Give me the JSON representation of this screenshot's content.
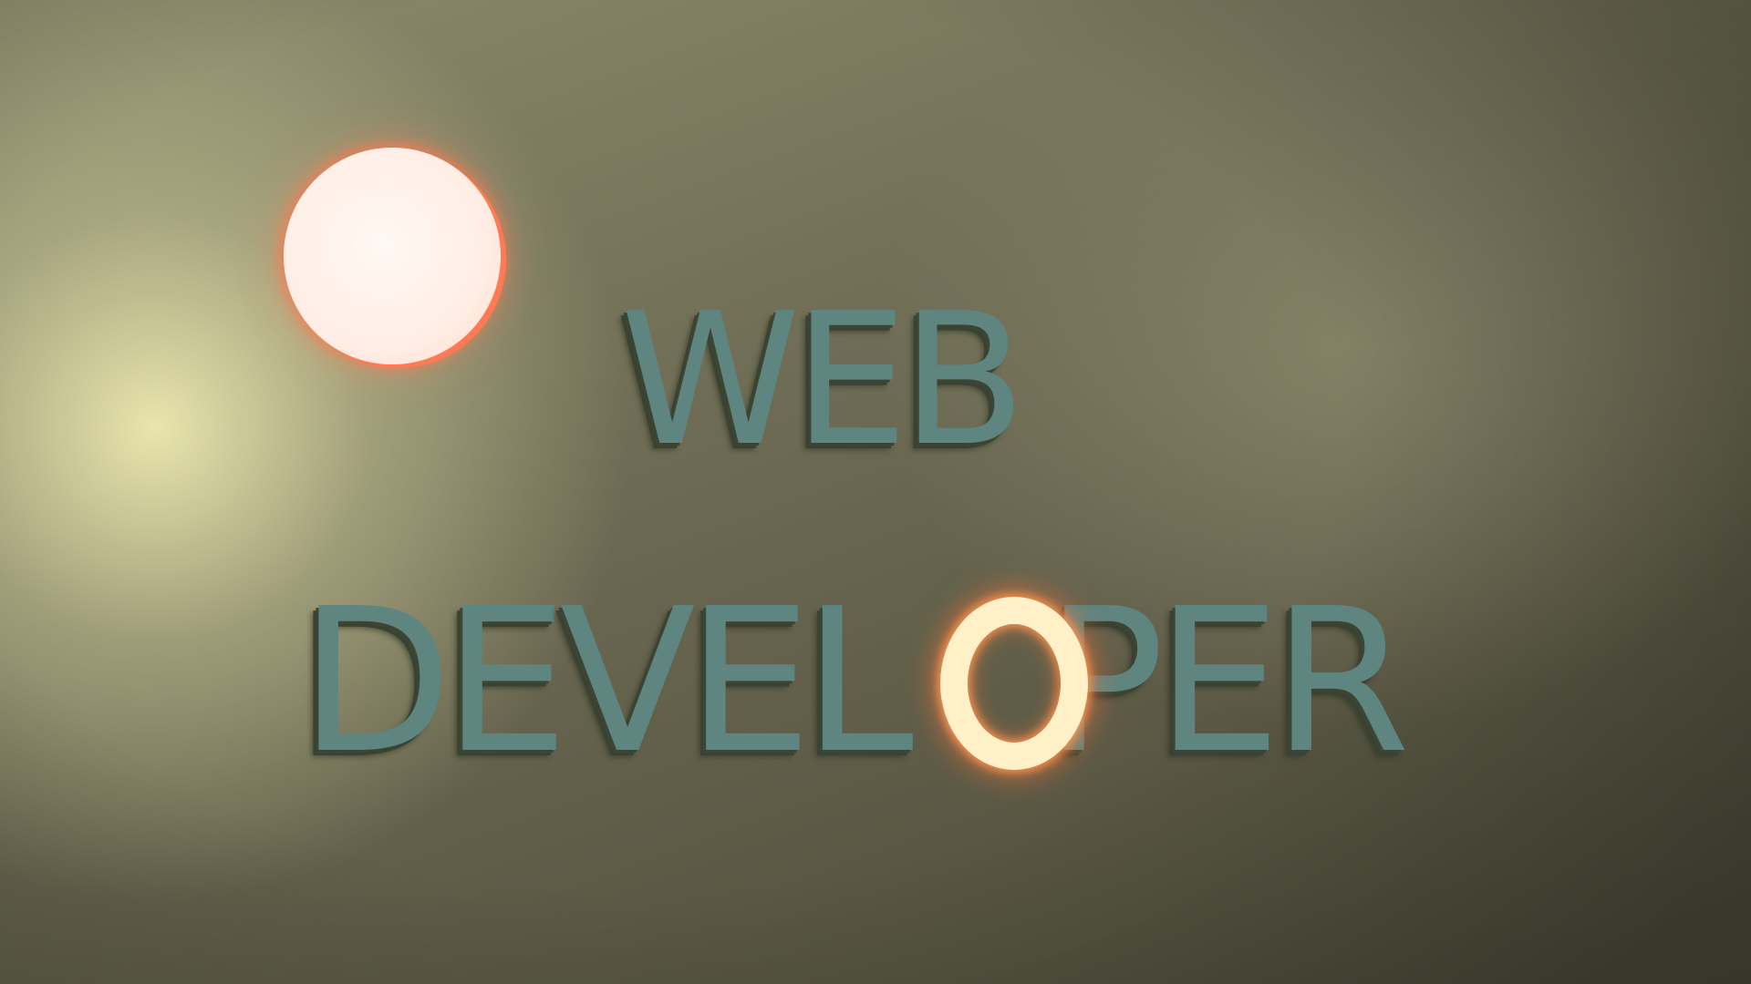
{
  "colors": {
    "background": "#6f6d55",
    "letters": "#5e8580",
    "sun": "#ffeee6",
    "glow": "#ff8a55"
  },
  "title": {
    "line1": "WEB",
    "line2": "DEVELOPER"
  },
  "line2_chars": [
    "D",
    "E",
    "V",
    "E",
    "L",
    " ",
    "P",
    "E",
    "R"
  ]
}
